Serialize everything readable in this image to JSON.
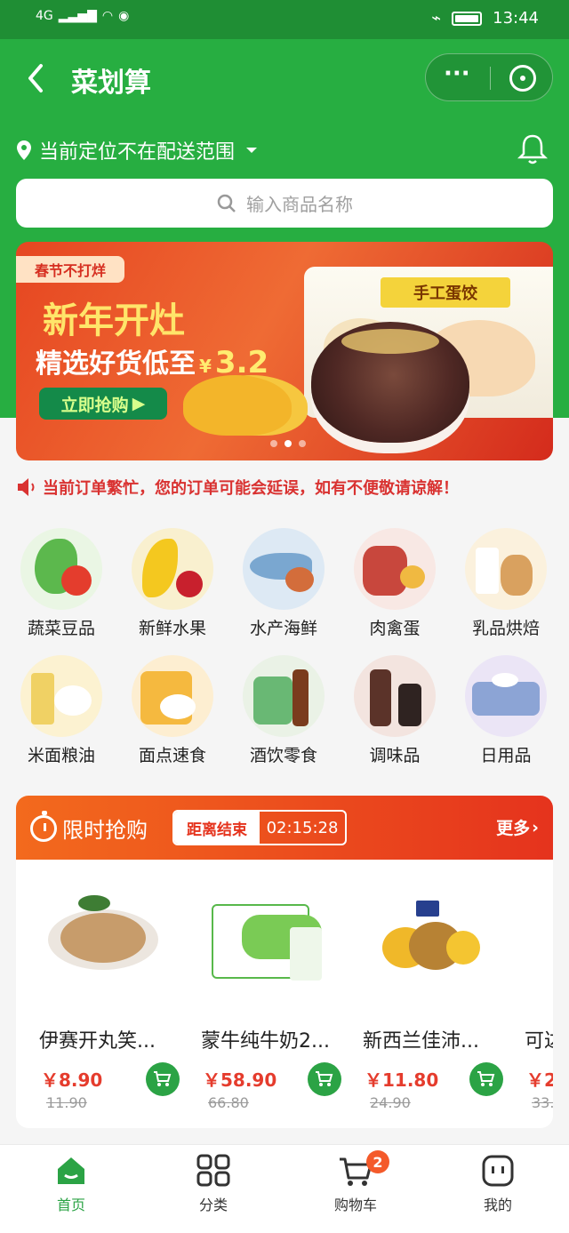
{
  "status_bar": {
    "network": "4G",
    "time": "13:44"
  },
  "header": {
    "title": "菜划算",
    "menu_icon": "more-dots-icon",
    "close_icon": "target-close-icon"
  },
  "location": {
    "text": "当前定位不在配送范围"
  },
  "search": {
    "placeholder": "输入商品名称"
  },
  "banner": {
    "tag": "春节不打烊",
    "title": "新年开灶",
    "subtitle": "精选好货低至",
    "currency": "¥",
    "price": "3.2",
    "button_label": "立即抢购",
    "product_brand": "手工蛋饺",
    "slides": 3,
    "active_slide": 2
  },
  "notice": {
    "text": "当前订单繁忙，您的订单可能会延误，如有不便敬请谅解！"
  },
  "categories": [
    {
      "label": "蔬菜豆品",
      "color": "#59b652"
    },
    {
      "label": "新鲜水果",
      "color": "#f4c81f"
    },
    {
      "label": "水产海鲜",
      "color": "#7aa7d0"
    },
    {
      "label": "肉禽蛋",
      "color": "#e9a5a0"
    },
    {
      "label": "乳品烘焙",
      "color": "#f3d69b"
    },
    {
      "label": "米面粮油",
      "color": "#f0d164"
    },
    {
      "label": "面点速食",
      "color": "#f5b93f"
    },
    {
      "label": "酒饮零食",
      "color": "#69b874"
    },
    {
      "label": "调味品",
      "color": "#5b3329"
    },
    {
      "label": "日用品",
      "color": "#8ca4d5"
    }
  ],
  "flash_sale": {
    "title": "限时抢购",
    "timer_label": "距离结束",
    "timer_value": "02:15:28",
    "more_label": "更多"
  },
  "products": [
    {
      "name": "伊赛开丸笑...",
      "price": "￥8.90",
      "old_price": "11.90"
    },
    {
      "name": "蒙牛纯牛奶2...",
      "price": "￥58.90",
      "old_price": "66.80"
    },
    {
      "name": "新西兰佳沛...",
      "price": "￥11.80",
      "old_price": "24.90"
    },
    {
      "name": "可达",
      "price": "￥2",
      "old_price": "33."
    }
  ],
  "tabbar": [
    {
      "label": "首页",
      "icon": "home-icon"
    },
    {
      "label": "分类",
      "icon": "grid-icon"
    },
    {
      "label": "购物车",
      "icon": "cart-icon",
      "badge": "2"
    },
    {
      "label": "我的",
      "icon": "profile-icon"
    }
  ]
}
